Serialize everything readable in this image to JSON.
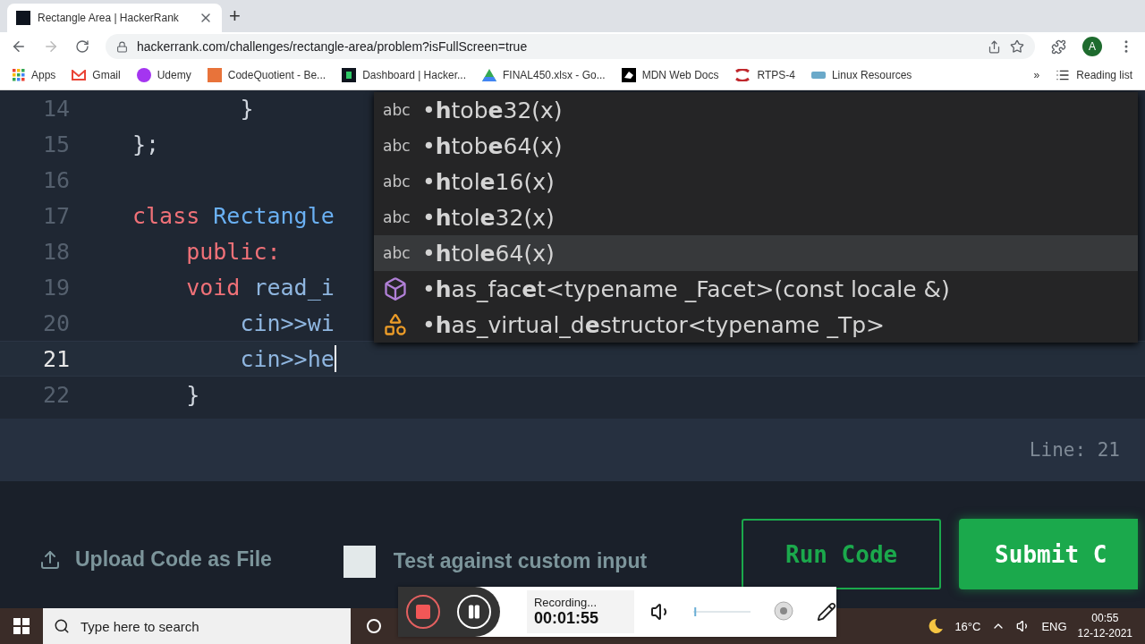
{
  "browser": {
    "tab": {
      "title": "Rectangle Area | HackerRank",
      "selected": true
    },
    "new_tab": "+",
    "url": "hackerrank.com/challenges/rectangle-area/problem?isFullScreen=true",
    "avatar": "A",
    "bookmarks": [
      {
        "kind": "apps",
        "label": "Apps"
      },
      {
        "kind": "gmail",
        "label": "Gmail"
      },
      {
        "kind": "udemy",
        "label": "Udemy"
      },
      {
        "kind": "cq",
        "label": "CodeQuotient - Be..."
      },
      {
        "kind": "hackerrank",
        "label": "Dashboard | Hacker..."
      },
      {
        "kind": "drive",
        "label": "FINAL450.xlsx - Go..."
      },
      {
        "kind": "mdn",
        "label": "MDN Web Docs"
      },
      {
        "kind": "rtps",
        "label": "RTPS-4"
      },
      {
        "kind": "ctt",
        "label": "Linux Resources"
      }
    ],
    "more": "»",
    "reading_list": "Reading list"
  },
  "editor": {
    "lines": [
      {
        "number": "14",
        "active": false,
        "tokens": [
          {
            "kind": "plain",
            "text": "        }"
          }
        ]
      },
      {
        "number": "15",
        "active": false,
        "tokens": [
          {
            "kind": "plain",
            "text": "};"
          }
        ]
      },
      {
        "number": "16",
        "active": false
      },
      {
        "number": "17",
        "active": false,
        "tokens": [
          {
            "kind": "keyword",
            "text": "class "
          },
          {
            "kind": "type",
            "text": "Rectangle"
          }
        ]
      },
      {
        "number": "18",
        "active": false,
        "tokens": [
          {
            "kind": "keyword",
            "text": "    public:"
          }
        ]
      },
      {
        "number": "19",
        "active": false,
        "tokens": [
          {
            "kind": "keyword",
            "text": "    void "
          },
          {
            "kind": "ident",
            "text": "read_i"
          }
        ]
      },
      {
        "number": "20",
        "active": false,
        "tokens": [
          {
            "kind": "ident",
            "text": "        cin>>wi"
          }
        ]
      },
      {
        "number": "21",
        "active": true,
        "tokens": [
          {
            "kind": "ident",
            "text": "        cin>>he"
          }
        ]
      },
      {
        "number": "22",
        "active": false,
        "tokens": [
          {
            "kind": "plain",
            "text": "    }"
          }
        ]
      }
    ],
    "autocomplete": [
      {
        "kind": "text",
        "tag": "abc",
        "label": "•**h**tob**e**32(x)",
        "selected": false
      },
      {
        "kind": "text",
        "tag": "abc",
        "label": "•**h**tob**e**64(x)",
        "selected": false
      },
      {
        "kind": "text",
        "tag": "abc",
        "label": "•**h**tol**e**16(x)",
        "selected": false
      },
      {
        "kind": "text",
        "tag": "abc",
        "label": "•**h**tol**e**32(x)",
        "selected": false
      },
      {
        "kind": "text",
        "tag": "abc",
        "label": "•**h**tol**e**64(x)",
        "selected": true
      },
      {
        "kind": "class",
        "label": "•**h**as_fac**e**t<typename _Facet>(const locale &)",
        "selected": false
      },
      {
        "kind": "struct",
        "label": "•**h**as_virtual_d**e**structor<typename _Tp>",
        "selected": false
      }
    ]
  },
  "status": {
    "position": "Line: 21"
  },
  "footer": {
    "upload": "Upload Code as File",
    "custom_input": {
      "label": "Test against custom input",
      "checked": false
    },
    "run": "Run Code",
    "submit": "Submit C"
  },
  "recorder": {
    "status": "Recording...",
    "time": "00:01:55",
    "volume": {
      "level": 0.02
    }
  },
  "taskbar": {
    "search_placeholder": "Type here to search",
    "temperature": "16°C",
    "language": "ENG",
    "time": "00:55",
    "date": "12-12-2021"
  }
}
